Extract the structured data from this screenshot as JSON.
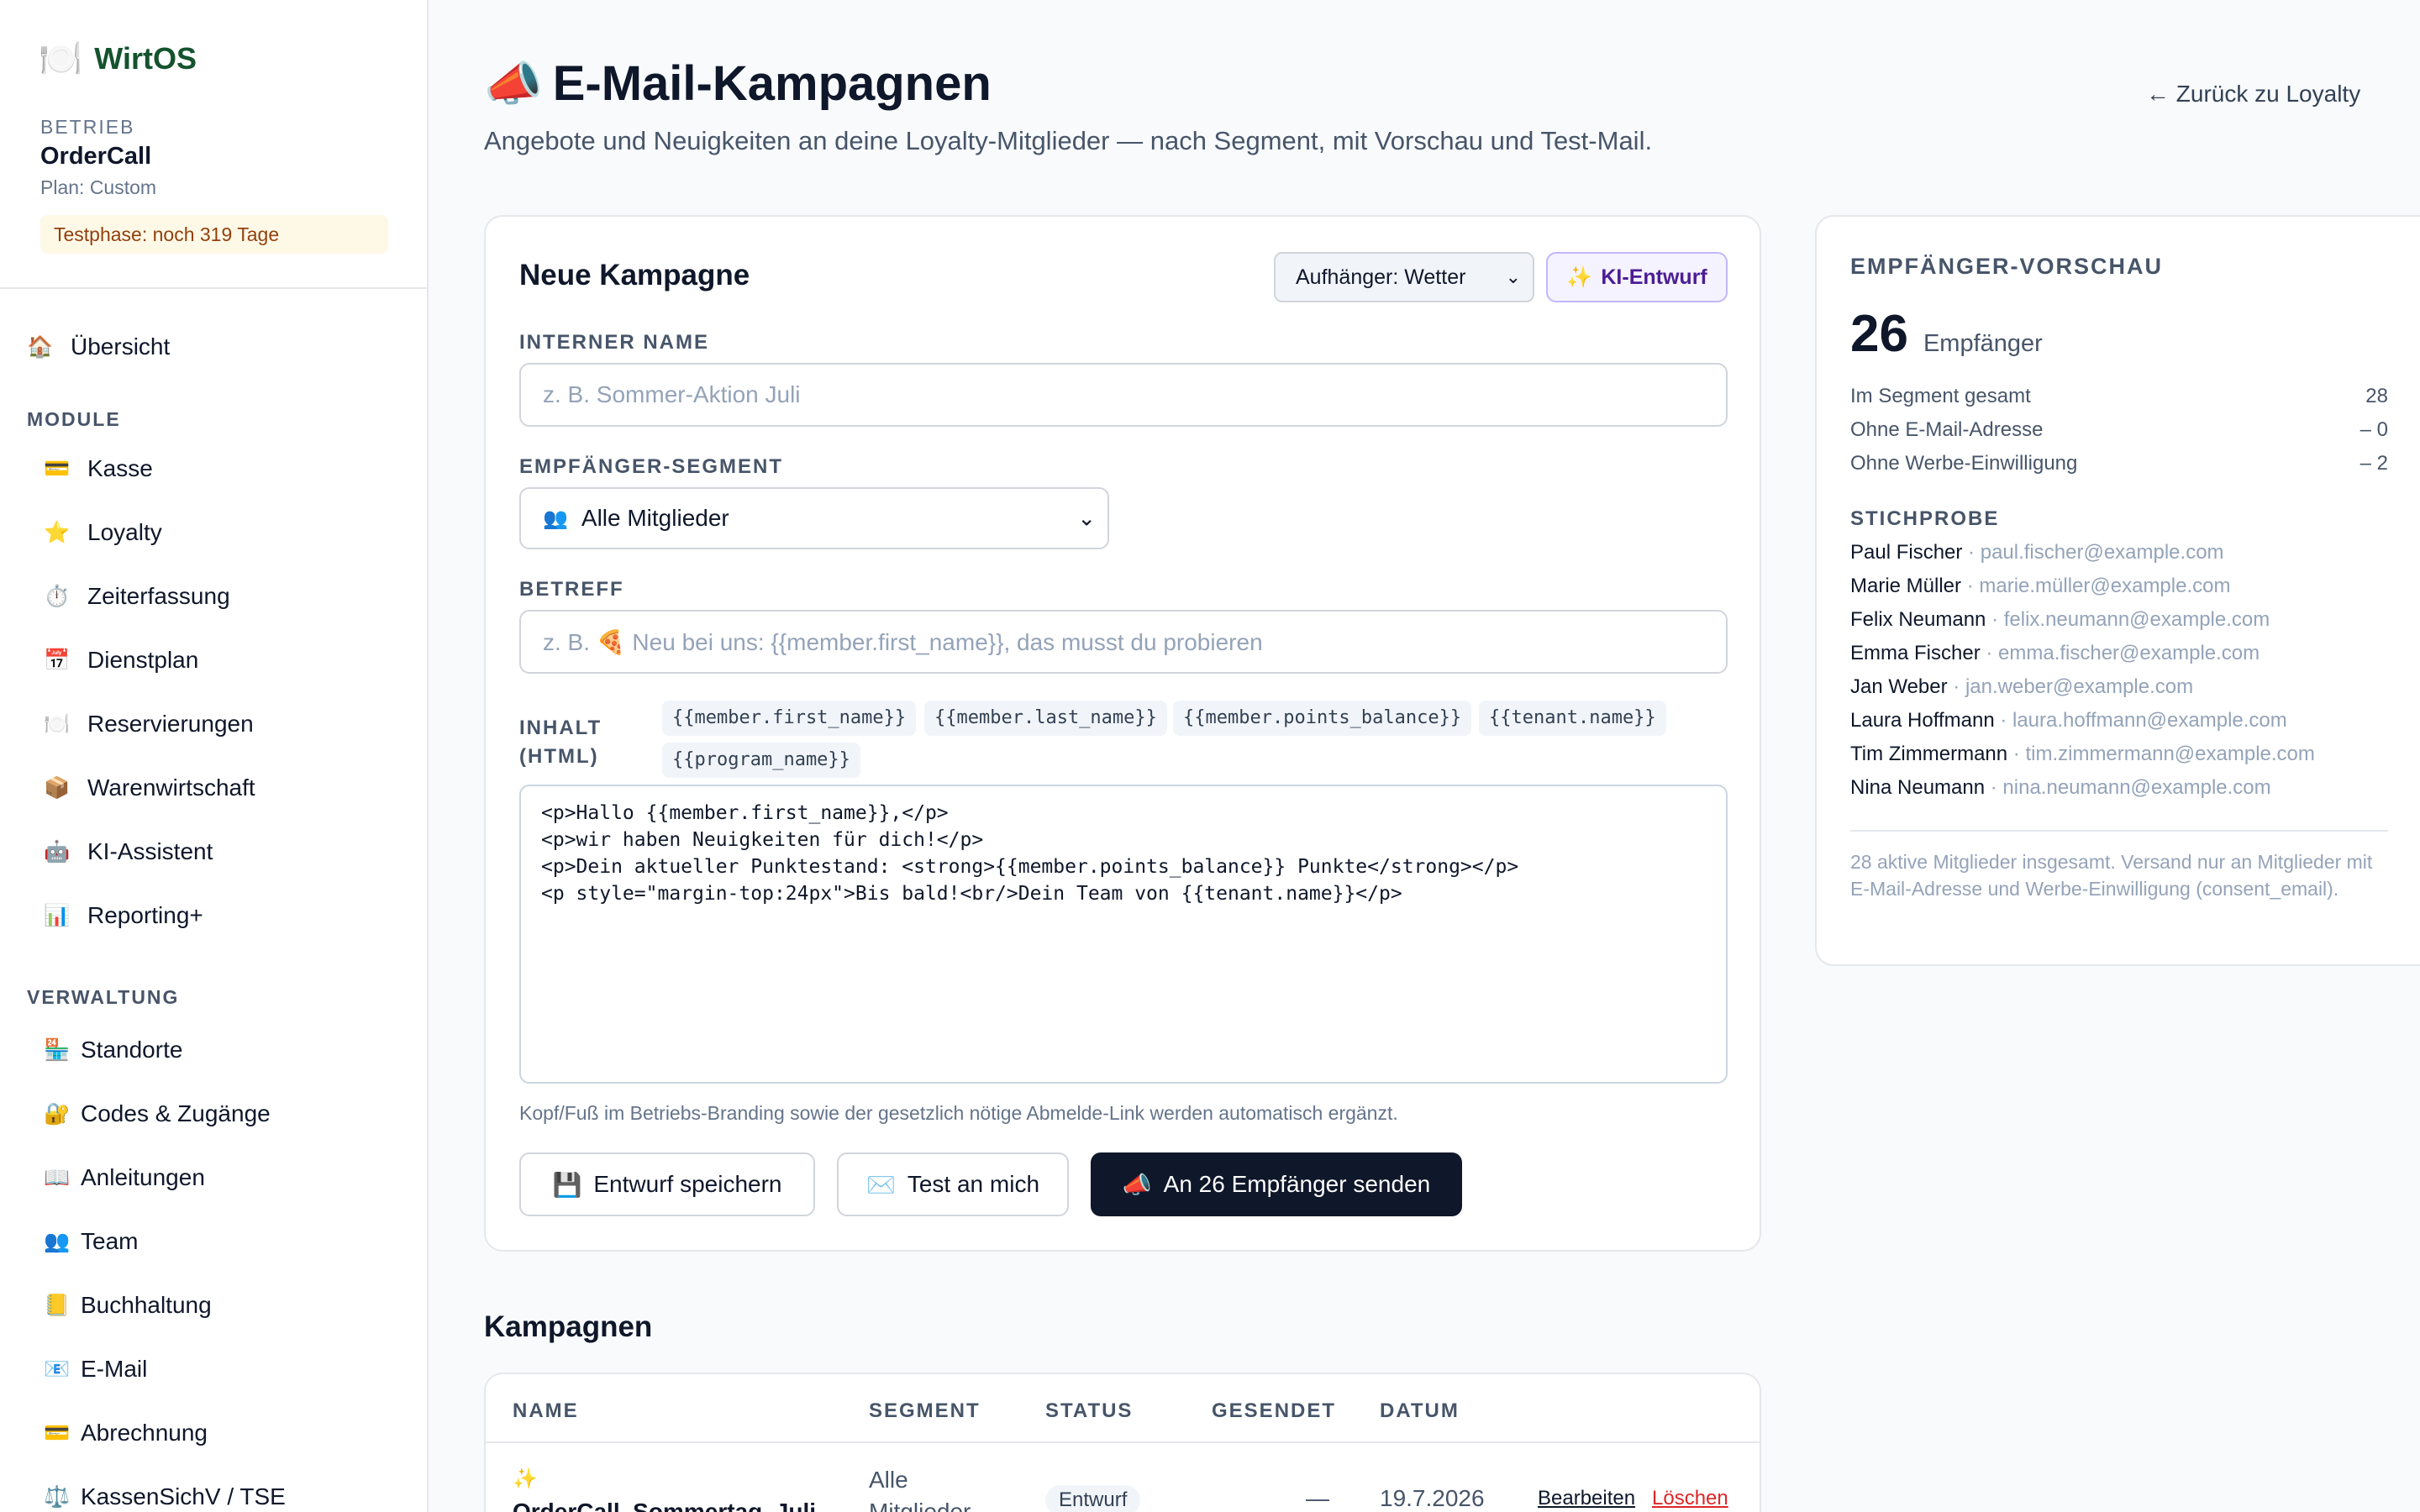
{
  "sidebar": {
    "brand_icon": "🍽️",
    "brand_name": "WirtOS",
    "betrieb_label": "Betrieb",
    "betrieb_name": "OrderCall",
    "plan": "Plan: Custom",
    "trial": "Testphase: noch 319 Tage",
    "overview": {
      "icon": "🏠",
      "label": "Übersicht"
    },
    "section_modules": "MODULE",
    "modules": [
      {
        "icon": "💳",
        "label": "Kasse"
      },
      {
        "icon": "⭐",
        "label": "Loyalty"
      },
      {
        "icon": "⏱️",
        "label": "Zeiterfassung"
      },
      {
        "icon": "📅",
        "label": "Dienstplan"
      },
      {
        "icon": "🍽️",
        "label": "Reservierungen"
      },
      {
        "icon": "📦",
        "label": "Warenwirtschaft"
      },
      {
        "icon": "🤖",
        "label": "KI-Assistent"
      },
      {
        "icon": "📊",
        "label": "Reporting+"
      }
    ],
    "section_admin": "VERWALTUNG",
    "admin": [
      {
        "icon": "🏪",
        "label": "Standorte"
      },
      {
        "icon": "🔐",
        "label": "Codes & Zugänge"
      },
      {
        "icon": "📖",
        "label": "Anleitungen"
      },
      {
        "icon": "👥",
        "label": "Team"
      },
      {
        "icon": "📒",
        "label": "Buchhaltung"
      },
      {
        "icon": "📧",
        "label": "E-Mail"
      },
      {
        "icon": "💳",
        "label": "Abrechnung"
      },
      {
        "icon": "⚖️",
        "label": "KassenSichV / TSE"
      }
    ]
  },
  "header": {
    "icon": "📣",
    "title": "E-Mail-Kampagnen",
    "subtitle": "Angebote und Neuigkeiten an deine Loyalty-Mitglieder — nach Segment, mit Vorschau und Test-Mail.",
    "back": "← Zurück zu Loyalty"
  },
  "form": {
    "title": "Neue Kampagne",
    "hook_select": "Aufhänger: Wetter",
    "ki_icon": "✨",
    "ki_label": "KI-Entwurf",
    "name_label": "Interner Name",
    "name_placeholder": "z. B. Sommer-Aktion Juli",
    "segment_label": "Empfänger-Segment",
    "segment_icon": "👥",
    "segment_value": "Alle Mitglieder",
    "subject_label": "Betreff",
    "subject_placeholder": "z. B. 🍕 Neu bei uns: {{member.first_name}}, das musst du probieren",
    "content_label_1": "INHALT",
    "content_label_2": "(HTML)",
    "placeholders": [
      "{{member.first_name}}",
      "{{member.last_name}}",
      "{{member.points_balance}}",
      "{{tenant.name}}",
      "{{program_name}}"
    ],
    "content": "<p>Hallo {{member.first_name}},</p>\n<p>wir haben Neuigkeiten für dich!</p>\n<p>Dein aktueller Punktestand: <strong>{{member.points_balance}} Punkte</strong></p>\n<p style=\"margin-top:24px\">Bis bald!<br/>Dein Team von {{tenant.name}}</p>",
    "hint": "Kopf/Fuß im Betriebs-Branding sowie der gesetzlich nötige Abmelde-Link werden automatisch ergänzt.",
    "save_icon": "💾",
    "save_label": "Entwurf speichern",
    "test_icon": "✉️",
    "test_label": "Test an mich",
    "send_icon": "📣",
    "send_label": "An 26 Empfänger senden"
  },
  "preview": {
    "title": "EMPFÄNGER-VORSCHAU",
    "count": "26",
    "count_unit": "Empfänger",
    "rows": [
      {
        "label": "Im Segment gesamt",
        "value": "28"
      },
      {
        "label": "Ohne E-Mail-Adresse",
        "value": "– 0"
      },
      {
        "label": "Ohne Werbe-Einwilligung",
        "value": "– 2"
      }
    ],
    "sample_title": "STICHPROBE",
    "samples": [
      {
        "name": "Paul Fischer",
        "email": " · paul.fischer@example.com"
      },
      {
        "name": "Marie Müller",
        "email": " · marie.müller@example.com"
      },
      {
        "name": "Felix Neumann",
        "email": " · felix.neumann@example.com"
      },
      {
        "name": "Emma Fischer",
        "email": " · emma.fischer@example.com"
      },
      {
        "name": "Jan Weber",
        "email": " · jan.weber@example.com"
      },
      {
        "name": "Laura Hoffmann",
        "email": " · laura.hoffmann@example.com"
      },
      {
        "name": "Tim Zimmermann",
        "email": " · tim.zimmermann@example.com"
      },
      {
        "name": "Nina Neumann",
        "email": " · nina.neumann@example.com"
      }
    ],
    "note": "28 aktive Mitglieder insgesamt. Versand nur an Mitglieder mit E-Mail-Adresse und Werbe-Einwilligung (consent_email)."
  },
  "campaigns": {
    "title": "Kampagnen",
    "columns": [
      "NAME",
      "SEGMENT",
      "STATUS",
      "GESENDET",
      "DATUM"
    ],
    "rows": [
      {
        "icon": "✨",
        "name": "OrderCall–Sommertag–Juli",
        "segment_1": "Alle",
        "segment_2": "Mitglieder",
        "status": "Entwurf",
        "sent": "—",
        "date": "19.7.2026",
        "edit": "Bearbeiten",
        "delete": "Löschen"
      }
    ]
  }
}
